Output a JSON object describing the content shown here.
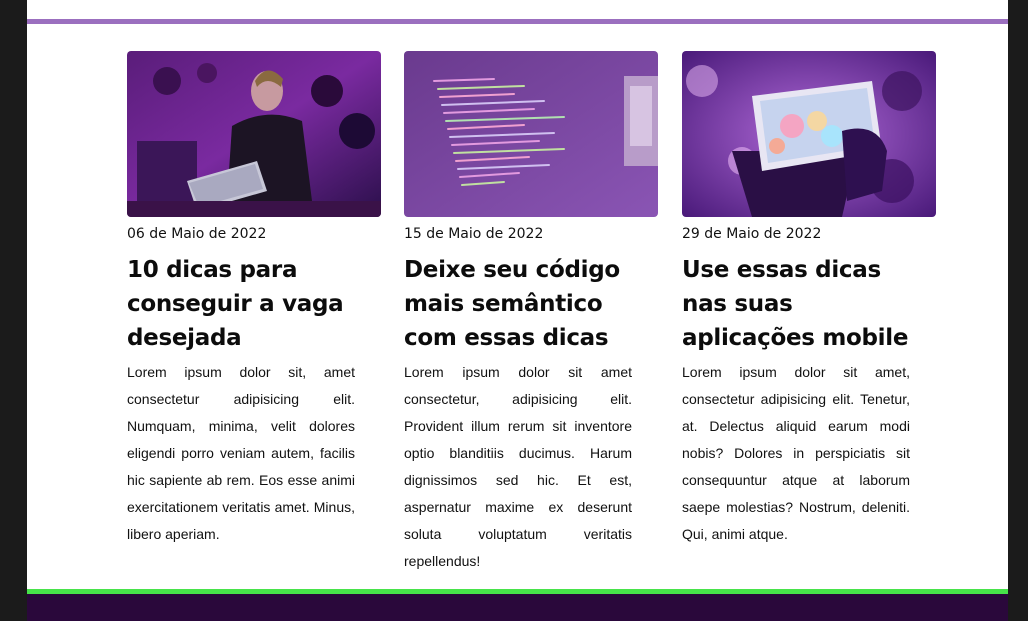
{
  "colors": {
    "top_rule": "#9b6fbf",
    "bottom_rule": "#47e34a",
    "footer": "#2a083b"
  },
  "posts": [
    {
      "image": "person-coding-laptop-photo",
      "date": "06 de Maio de 2022",
      "title": "10 dicas para conseguir a vaga desejada",
      "body": "Lorem ipsum dolor sit, amet consectetur adipisicing elit. Numquam, minima, velit dolores eligendi porro veniam autem, facilis hic sapiente ab rem. Eos esse animi exercitationem veritatis amet. Minus, libero aperiam."
    },
    {
      "image": "code-on-screen-photo",
      "date": "15 de Maio de 2022",
      "title": "Deixe seu código mais semântico com essas dicas",
      "body": "Lorem ipsum dolor sit amet consectetur, adipisicing elit. Provident illum rerum sit inventore optio blanditiis ducimus. Harum dignissimos sed hic. Et est, aspernatur maxime ex deserunt soluta voluptatum veritatis repellendus!"
    },
    {
      "image": "hand-holding-smartphone-photo",
      "date": "29 de Maio de 2022",
      "title": "Use essas dicas nas suas aplicações mobile",
      "body": "Lorem ipsum dolor sit amet, consectetur adipisicing elit. Tenetur, at. Delectus aliquid earum modi nobis? Dolores in perspiciatis sit consequuntur atque at laborum saepe molestias? Nostrum, deleniti. Qui, animi atque."
    }
  ]
}
